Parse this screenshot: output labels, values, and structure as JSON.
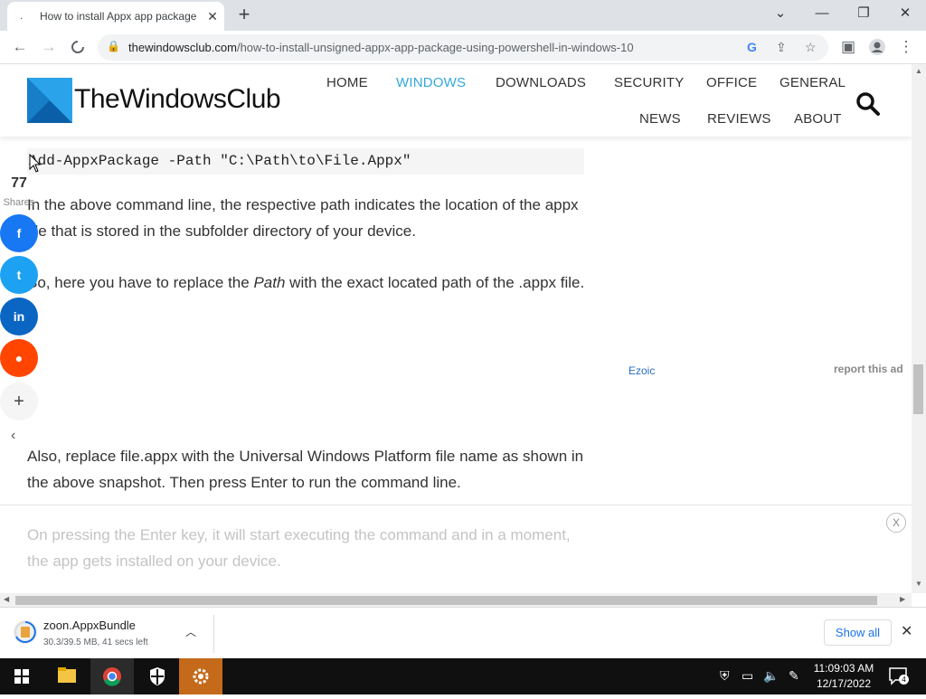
{
  "browser": {
    "tab_title": "How to install Appx app package",
    "tab_favicon": ".",
    "url_domain": "thewindowsclub.com",
    "url_path": "/how-to-install-unsigned-appx-app-package-using-powershell-in-windows-10"
  },
  "site": {
    "logo_text": "TheWindowsClub",
    "nav": [
      "HOME",
      "WINDOWS",
      "DOWNLOADS",
      "SECURITY",
      "OFFICE",
      "GENERAL",
      "NEWS",
      "REVIEWS",
      "ABOUT"
    ],
    "active_nav": "WINDOWS",
    "accent_color": "#35a8dc"
  },
  "article": {
    "code": "Add-AppxPackage -Path \"C:\\Path\\to\\File.Appx\"",
    "para1": "In the above command line, the respective path indicates the location of the appx file that is stored in the subfolder directory of your device.",
    "para2_a": "So, here you have to replace the ",
    "para2_italic": "Path",
    "para2_b": " with the exact located path of the .appx file.",
    "para3": "Also, replace file.appx with the Universal Windows Platform file name as shown in the above snapshot. Then press Enter to run the command line.",
    "para4": "On pressing the Enter key, it will start executing the command and in a moment, the app gets installed on your device."
  },
  "share": {
    "count": "77",
    "label": "Shares",
    "more": "+"
  },
  "ad": {
    "ezoic_label": "Ezoic",
    "report": "report this ad",
    "close": "X"
  },
  "downloads": {
    "file_name": "zoon.AppxBundle",
    "status": "30.3/39.5 MB, 41 secs left",
    "show_all": "Show all"
  },
  "taskbar": {
    "time": "11:09:03 AM",
    "date": "12/17/2022",
    "notifications": "4"
  }
}
